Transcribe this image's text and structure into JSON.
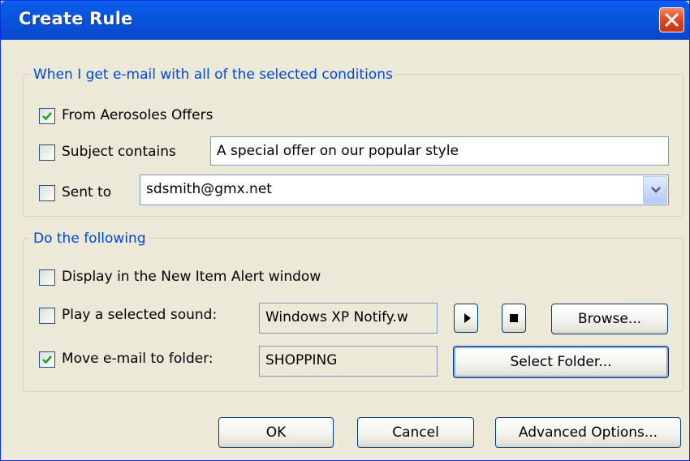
{
  "dialog": {
    "title": "Create Rule"
  },
  "conditions": {
    "legend": "When I get e-mail with all of the selected conditions",
    "from": {
      "label": "From Aerosoles Offers",
      "checked": true
    },
    "subject": {
      "label": "Subject contains",
      "checked": false,
      "value": "A special offer on our popular style"
    },
    "sent_to": {
      "label": "Sent to",
      "checked": false,
      "value": "sdsmith@gmx.net"
    }
  },
  "actions": {
    "legend": "Do the following",
    "alert": {
      "label": "Display in the New Item Alert window",
      "checked": false
    },
    "sound": {
      "label": "Play a selected sound:",
      "checked": false,
      "value": "Windows XP Notify.w",
      "browse_label": "Browse..."
    },
    "move": {
      "label": "Move e-mail to folder:",
      "checked": true,
      "value": "SHOPPING",
      "select_label": "Select Folder..."
    }
  },
  "buttons": {
    "ok": "OK",
    "cancel": "Cancel",
    "advanced": "Advanced Options..."
  },
  "icons": {
    "close": "close-icon",
    "check": "checkmark-icon",
    "dropdown": "chevron-down-icon",
    "play": "play-icon",
    "stop": "stop-icon"
  },
  "colors": {
    "title_bar": "#0a5be6",
    "legend_text": "#0046d5",
    "dialog_bg": "#ece9d8",
    "close_button": "#e2431f"
  }
}
